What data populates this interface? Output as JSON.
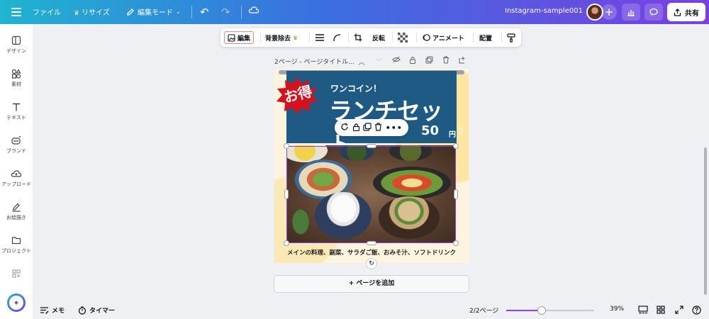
{
  "topbar": {
    "file": "ファイル",
    "resize": "リサイズ",
    "mode": "編集モード",
    "doc_title": "Instagram-sample001",
    "share": "共有"
  },
  "sidebar": {
    "items": [
      {
        "label": "デザイン",
        "icon": "design-icon"
      },
      {
        "label": "素材",
        "icon": "elements-icon"
      },
      {
        "label": "テキスト",
        "icon": "text-icon"
      },
      {
        "label": "ブランド",
        "icon": "brand-icon"
      },
      {
        "label": "アップロード",
        "icon": "upload-icon"
      },
      {
        "label": "お絵描き",
        "icon": "draw-icon"
      },
      {
        "label": "プロジェクト",
        "icon": "folder-icon"
      }
    ]
  },
  "context_toolbar": {
    "edit": "編集",
    "bg_remove": "背景除去",
    "flip": "反転",
    "animate": "アニメート",
    "position": "配置"
  },
  "page_header": {
    "title": "2ページ - ページタイトル..."
  },
  "design": {
    "badge": "お得",
    "subtitle": "ワンコイン！",
    "headline": "ランチセット",
    "price": "50",
    "yen": "円",
    "tax": "税込",
    "caption": "メインの料理、副菜、サラダご飯、おみそ汁、ソフトドリンク"
  },
  "add_page": "+ ページを追加",
  "bottom": {
    "memo": "メモ",
    "timer": "タイマー",
    "page_count": "2/2ページ",
    "zoom": "39%",
    "zoom_level": 0.39
  },
  "colors": {
    "accent": "#8b3dff",
    "banner": "#1f5a84",
    "badge": "#d6101d"
  }
}
